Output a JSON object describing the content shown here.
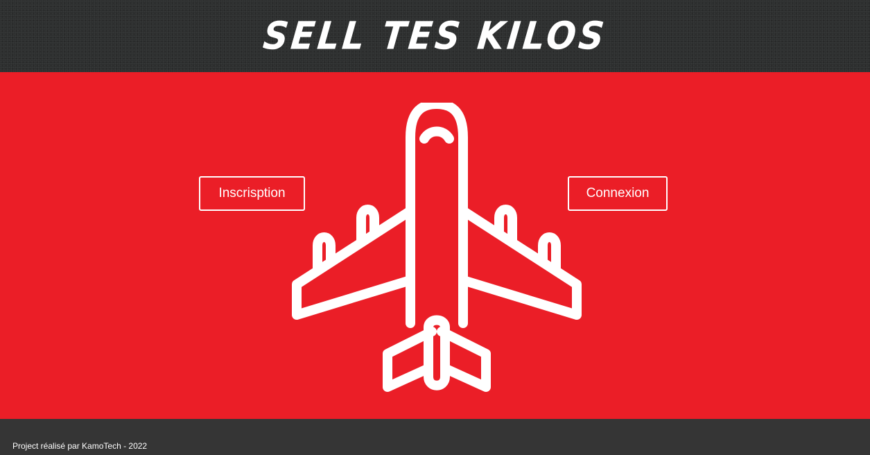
{
  "header": {
    "title": "SELL TES KILOS"
  },
  "hero": {
    "background_color": "#eb1e27",
    "illustration": "airplane-icon",
    "buttons": {
      "inscription_label": "Inscrisption",
      "connexion_label": "Connexion"
    }
  },
  "footer": {
    "text": "Project réalisé par KamoTech - 2022"
  }
}
